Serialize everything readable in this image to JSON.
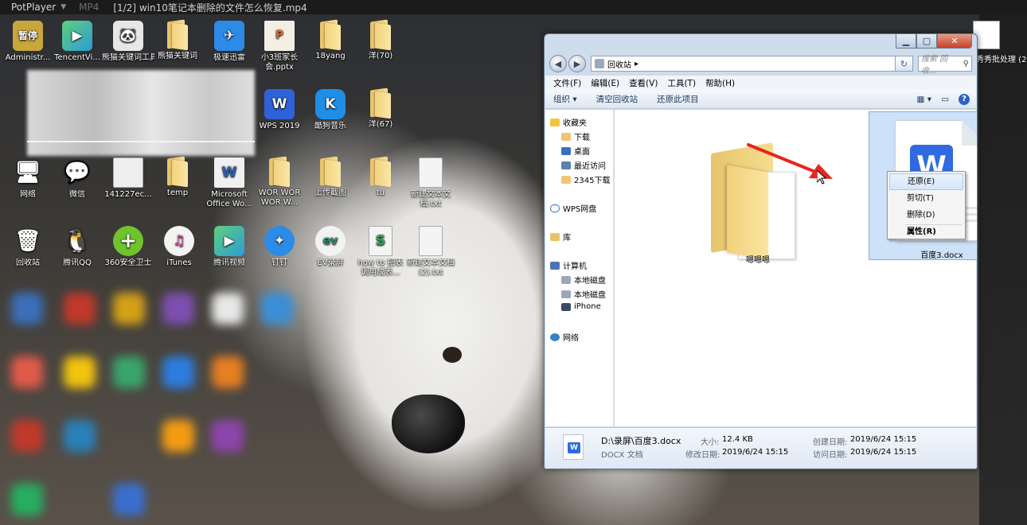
{
  "player": {
    "app_name": "PotPlayer",
    "format": "MP4",
    "title": "[1/2] win10笔记本删除的文件怎么恢复.mp4"
  },
  "desktop": {
    "icons_row1": [
      {
        "label": "Administr...",
        "icon": "admin-icon",
        "color": "#c9a63c",
        "glyph": "暂停"
      },
      {
        "label": "TencentVi...",
        "icon": "tencent-video-icon",
        "color": "#2d9bd6",
        "glyph": "▶"
      },
      {
        "label": "熊猫关键词工具.exe",
        "icon": "panda-icon",
        "color": "#e7e7e7",
        "glyph": "🐼"
      },
      {
        "label": "熊猫关键词",
        "icon": "folder-icon",
        "color": "folder",
        "glyph": ""
      },
      {
        "label": "极速迅雷",
        "icon": "xunlei-icon",
        "color": "#2b8be6",
        "glyph": "✈"
      },
      {
        "label": "小3班家长会.pptx",
        "icon": "pptx-icon",
        "color": "#f4efe3",
        "glyph": "P"
      },
      {
        "label": "18yang",
        "icon": "folder-icon",
        "color": "folder",
        "glyph": ""
      },
      {
        "label": "洋(70)",
        "icon": "folder-icon",
        "color": "folder",
        "glyph": ""
      }
    ],
    "icons_row2": [
      {
        "label": "WPS 2019",
        "icon": "wps-icon",
        "color": "#2f62d8",
        "glyph": "W"
      },
      {
        "label": "酷狗音乐",
        "icon": "kugou-icon",
        "color": "#1f8ee6",
        "glyph": "K"
      },
      {
        "label": "洋(67)",
        "icon": "folder-icon",
        "color": "folder",
        "glyph": ""
      }
    ],
    "icons_row3": [
      {
        "label": "网络",
        "icon": "network-icon",
        "color": "#3a7fc8",
        "glyph": "🖥"
      },
      {
        "label": "微信",
        "icon": "wechat-icon",
        "color": "#2fb444",
        "glyph": "💬"
      },
      {
        "label": "141227ec...",
        "icon": "image-file-icon",
        "color": "#eeeeee",
        "glyph": ""
      },
      {
        "label": "temp",
        "icon": "folder-icon",
        "color": "folder",
        "glyph": ""
      },
      {
        "label": "Microsoft Office Wo...",
        "icon": "word-icon",
        "color": "#f0f0f0",
        "glyph": "W"
      },
      {
        "label": "WOR WOR WOR W...",
        "icon": "folder-icon",
        "color": "folder",
        "glyph": ""
      },
      {
        "label": "上传截图",
        "icon": "folder-icon",
        "color": "folder",
        "glyph": ""
      },
      {
        "label": "tu",
        "icon": "folder-icon",
        "color": "folder",
        "glyph": ""
      },
      {
        "label": "新建文本文档.txt",
        "icon": "txt-icon",
        "color": "#f4f4f4",
        "glyph": ""
      }
    ],
    "icons_row4": [
      {
        "label": "回收站",
        "icon": "recycle-bin-icon",
        "color": "#c8d6e6",
        "glyph": "🗑"
      },
      {
        "label": "腾讯QQ",
        "icon": "qq-icon",
        "color": "transparent",
        "glyph": "🐧"
      },
      {
        "label": "360安全卫士",
        "icon": "360-icon",
        "color": "#6fc42e",
        "glyph": "+"
      },
      {
        "label": "iTunes",
        "icon": "itunes-icon",
        "color": "#f3f3f3",
        "glyph": "♫"
      },
      {
        "label": "腾讯视频",
        "icon": "tencent-video-icon",
        "color": "#2d9bd6",
        "glyph": "▶"
      },
      {
        "label": "钉钉",
        "icon": "dingtalk-icon",
        "color": "#2b8be6",
        "glyph": "✦"
      },
      {
        "label": "EV录屏",
        "icon": "ev-recorder-icon",
        "color": "#f2f2f2",
        "glyph": "ev"
      },
      {
        "label": "how to 把表调用成表...",
        "icon": "spreadsheet-icon",
        "color": "#2f9d55",
        "glyph": "S"
      },
      {
        "label": "新建文本文档(2).txt",
        "icon": "txt-icon",
        "color": "#f4f4f4",
        "glyph": ""
      }
    ],
    "right_edge_label": "秀秀批处理 (2"
  },
  "explorer": {
    "address": "回收站",
    "search_placeholder": "搜索 回收...",
    "menu": [
      "文件(F)",
      "编辑(E)",
      "查看(V)",
      "工具(T)",
      "帮助(H)"
    ],
    "commands": [
      "组织 ▾",
      "清空回收站",
      "还原此项目"
    ],
    "nav": {
      "favorites": "收藏夹",
      "downloads": "下载",
      "desktop": "桌面",
      "recent": "最近访问",
      "folder2345": "2345下载",
      "wps": "WPS网盘",
      "library": "库",
      "computer": "计算机",
      "disk1": "本地磁盘",
      "disk2": "本地磁盘",
      "iphone": "iPhone",
      "network": "网络"
    },
    "items": {
      "folder_label": "嗯嗯嗯",
      "doc_label": "百度3.docx"
    },
    "context_menu": [
      "还原(E)",
      "剪切(T)",
      "删除(D)",
      "属性(R)"
    ],
    "details": {
      "path": "D:\\录屏\\百度3.docx",
      "type": "DOCX 文档",
      "size_label": "大小:",
      "size": "12.4 KB",
      "modified_label": "修改日期:",
      "modified": "2019/6/24 15:15",
      "created_label": "创建日期:",
      "created": "2019/6/24 15:15",
      "accessed_label": "访问日期:",
      "accessed": "2019/6/24 15:15"
    }
  }
}
